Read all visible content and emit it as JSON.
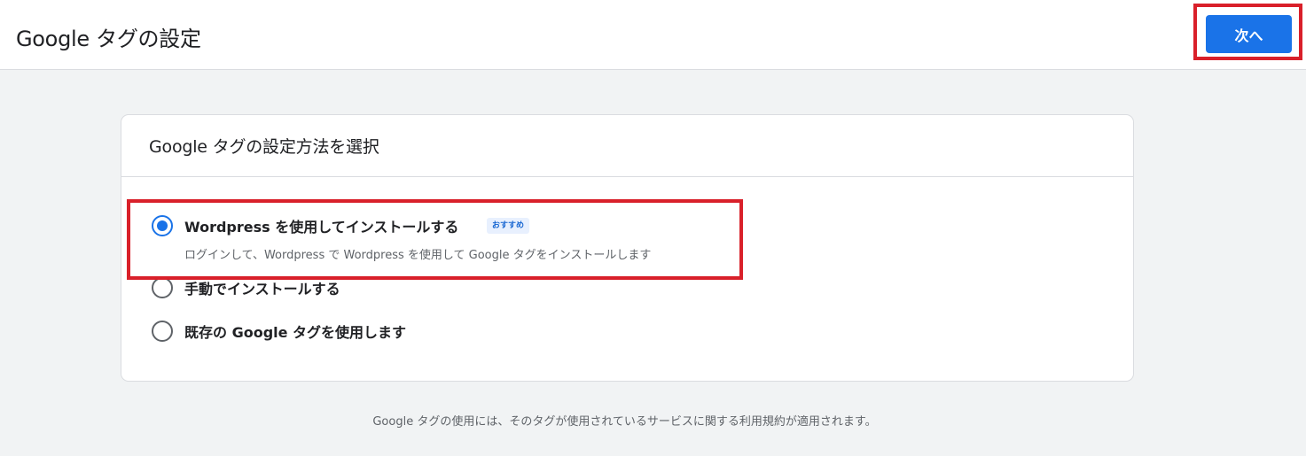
{
  "header": {
    "title": "Google タグの設定",
    "next_label": "次へ"
  },
  "card": {
    "title": "Google タグの設定方法を選択",
    "options": [
      {
        "label": "Wordpress を使用してインストールする",
        "badge": "おすすめ",
        "description": "ログインして、Wordpress で Wordpress を使用して Google タグをインストールします",
        "selected": true
      },
      {
        "label": "手動でインストールする",
        "selected": false
      },
      {
        "label": "既存の Google タグを使用します",
        "selected": false
      }
    ]
  },
  "footer": {
    "text": "Google タグの使用には、そのタグが使用されているサービスに関する利用規約が適用されます。"
  },
  "colors": {
    "primary": "#1a73e8",
    "highlight": "#d9202a",
    "badge_bg": "#e8f0fe"
  }
}
